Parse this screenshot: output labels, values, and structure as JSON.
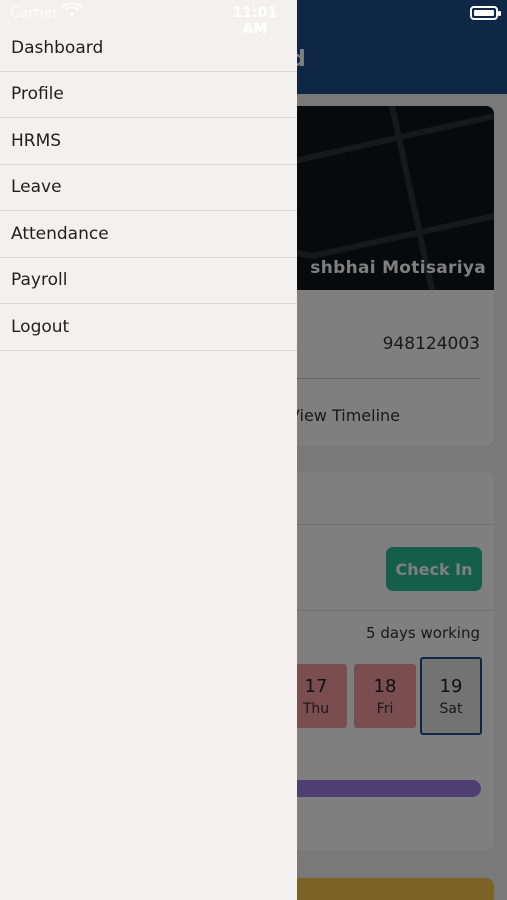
{
  "status_bar": {
    "carrier": "Carrier",
    "time": "11:01 AM"
  },
  "app": {
    "header_title_partial": "d",
    "profile": {
      "name_partial": "shbhai Motisariya",
      "phone_partial": "948124003",
      "view_timeline": "View Timeline"
    },
    "attendance": {
      "check_in_label": "Check In",
      "working_days": "5 days working",
      "days": [
        {
          "num": "17",
          "name": "Thu",
          "state": "absent"
        },
        {
          "num": "18",
          "name": "Fri",
          "state": "absent"
        },
        {
          "num": "19",
          "name": "Sat",
          "state": "selected"
        }
      ]
    }
  },
  "drawer": {
    "items": [
      {
        "label": "Dashboard"
      },
      {
        "label": "Profile"
      },
      {
        "label": "HRMS"
      },
      {
        "label": "Leave"
      },
      {
        "label": "Attendance"
      },
      {
        "label": "Payroll"
      },
      {
        "label": "Logout"
      }
    ]
  },
  "colors": {
    "header_blue": "#1c4f8d",
    "check_in_green": "#2bbd8e",
    "absent_red": "#f49c9c",
    "progress_purple": "#9b7fe3",
    "drawer_bg": "#f2f1ef"
  },
  "icons": {
    "status_wifi": "wifi-icon",
    "status_battery": "battery-icon"
  }
}
